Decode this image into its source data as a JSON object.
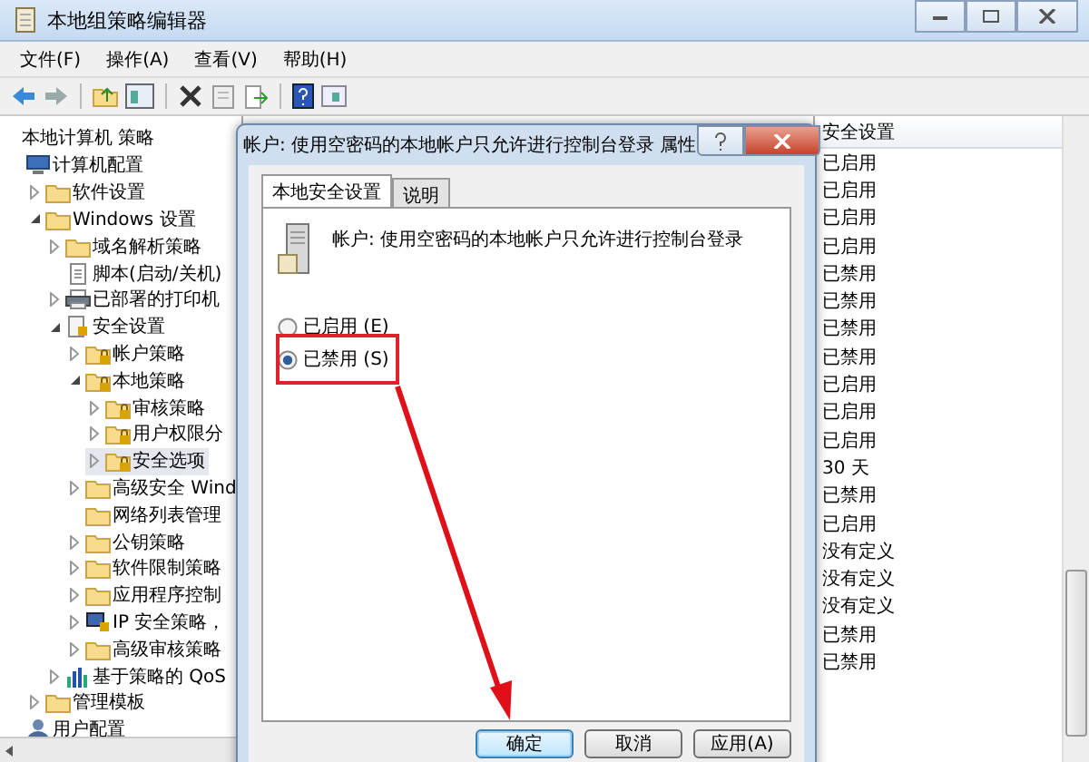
{
  "window": {
    "title": "本地组策略编辑器"
  },
  "menu": [
    "文件(F)",
    "操作(A)",
    "查看(V)",
    "帮助(H)"
  ],
  "tree": {
    "root": "本地计算机 策略",
    "items": [
      {
        "label": "计算机配置",
        "kind": "computer",
        "selected": false,
        "children": [
          {
            "label": "软件设置",
            "kind": "folder",
            "expanded": false,
            "selected": false
          },
          {
            "label": "Windows 设置",
            "kind": "folder",
            "expanded": true,
            "selected": false,
            "children": [
              {
                "label": "域名解析策略",
                "kind": "folder",
                "expanded": false,
                "selected": false
              },
              {
                "label": "脚本(启动/关机)",
                "kind": "script",
                "selected": false
              },
              {
                "label": "已部署的打印机",
                "kind": "printer",
                "expanded": false,
                "selected": false
              },
              {
                "label": "安全设置",
                "kind": "secure",
                "expanded": true,
                "selected": false,
                "children": [
                  {
                    "label": "帐户策略",
                    "kind": "lockfolder",
                    "expanded": false,
                    "selected": false
                  },
                  {
                    "label": "本地策略",
                    "kind": "lockfolder",
                    "expanded": true,
                    "selected": false,
                    "children": [
                      {
                        "label": "审核策略",
                        "kind": "lockfolder",
                        "expanded": false,
                        "selected": false
                      },
                      {
                        "label": "用户权限分",
                        "kind": "lockfolder",
                        "expanded": false,
                        "selected": false
                      },
                      {
                        "label": "安全选项",
                        "kind": "lockfolder",
                        "expanded": false,
                        "selected": true
                      }
                    ]
                  },
                  {
                    "label": "高级安全 Wind",
                    "kind": "folder",
                    "expanded": false,
                    "selected": false
                  },
                  {
                    "label": "网络列表管理",
                    "kind": "folder",
                    "selected": false
                  },
                  {
                    "label": "公钥策略",
                    "kind": "folder",
                    "expanded": false,
                    "selected": false
                  },
                  {
                    "label": "软件限制策略",
                    "kind": "folder",
                    "expanded": false,
                    "selected": false
                  },
                  {
                    "label": "应用程序控制",
                    "kind": "folder",
                    "expanded": false,
                    "selected": false
                  },
                  {
                    "label": "IP 安全策略，",
                    "kind": "network",
                    "expanded": false,
                    "selected": false
                  },
                  {
                    "label": "高级审核策略",
                    "kind": "folder",
                    "expanded": false,
                    "selected": false
                  }
                ]
              },
              {
                "label": "基于策略的 QoS",
                "kind": "chart",
                "expanded": false,
                "selected": false
              }
            ]
          },
          {
            "label": "管理模板",
            "kind": "folder",
            "expanded": false,
            "selected": false
          }
        ]
      },
      {
        "label": "用户配置",
        "kind": "user",
        "selected": false
      }
    ]
  },
  "list": {
    "header": "安全设置",
    "rows": [
      "已启用",
      "已启用",
      "已启用",
      "已启用",
      "已禁用",
      "已禁用",
      "已禁用",
      "已禁用",
      "已启用",
      "已启用",
      "已启用",
      "30 天",
      "已禁用",
      "已启用",
      "没有定义",
      "没有定义",
      "没有定义",
      "已禁用",
      "已禁用"
    ]
  },
  "dialog": {
    "title": "帐户: 使用空密码的本地帐户只允许进行控制台登录 属性",
    "tabs": [
      {
        "label": "本地安全设置",
        "selected": true
      },
      {
        "label": "说明",
        "selected": false
      }
    ],
    "heading": "帐户: 使用空密码的本地帐户只允许进行控制台登录",
    "options": [
      {
        "label": "已启用 (E)",
        "selected": false
      },
      {
        "label": "已禁用 (S)",
        "selected": true
      }
    ],
    "buttons": [
      {
        "label": "确定",
        "default": true
      },
      {
        "label": "取消",
        "default": false
      },
      {
        "label": "应用(A)",
        "default": false
      }
    ]
  }
}
